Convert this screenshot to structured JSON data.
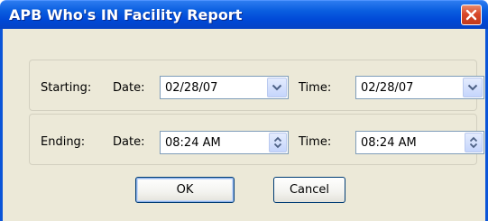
{
  "window": {
    "title": "APB Who's IN Facility Report"
  },
  "starting": {
    "section_label": "Starting:",
    "date_label": "Date:",
    "date_value": "02/28/07",
    "time_label": "Time:",
    "time_value": "02/28/07"
  },
  "ending": {
    "section_label": "Ending:",
    "date_label": "Date:",
    "date_value": "08:24 AM",
    "time_label": "Time:",
    "time_value": "08:24 AM"
  },
  "buttons": {
    "ok_label": "OK",
    "cancel_label": "Cancel"
  },
  "icons": {
    "close": "close-icon",
    "dropdown": "chevron-down-icon",
    "spinner": "spinner-arrows-icon"
  },
  "colors": {
    "titlebar": "#0a5ee0",
    "dialog_bg": "#ece9d8",
    "close_button": "#d8482a",
    "field_border": "#7f9db9"
  }
}
